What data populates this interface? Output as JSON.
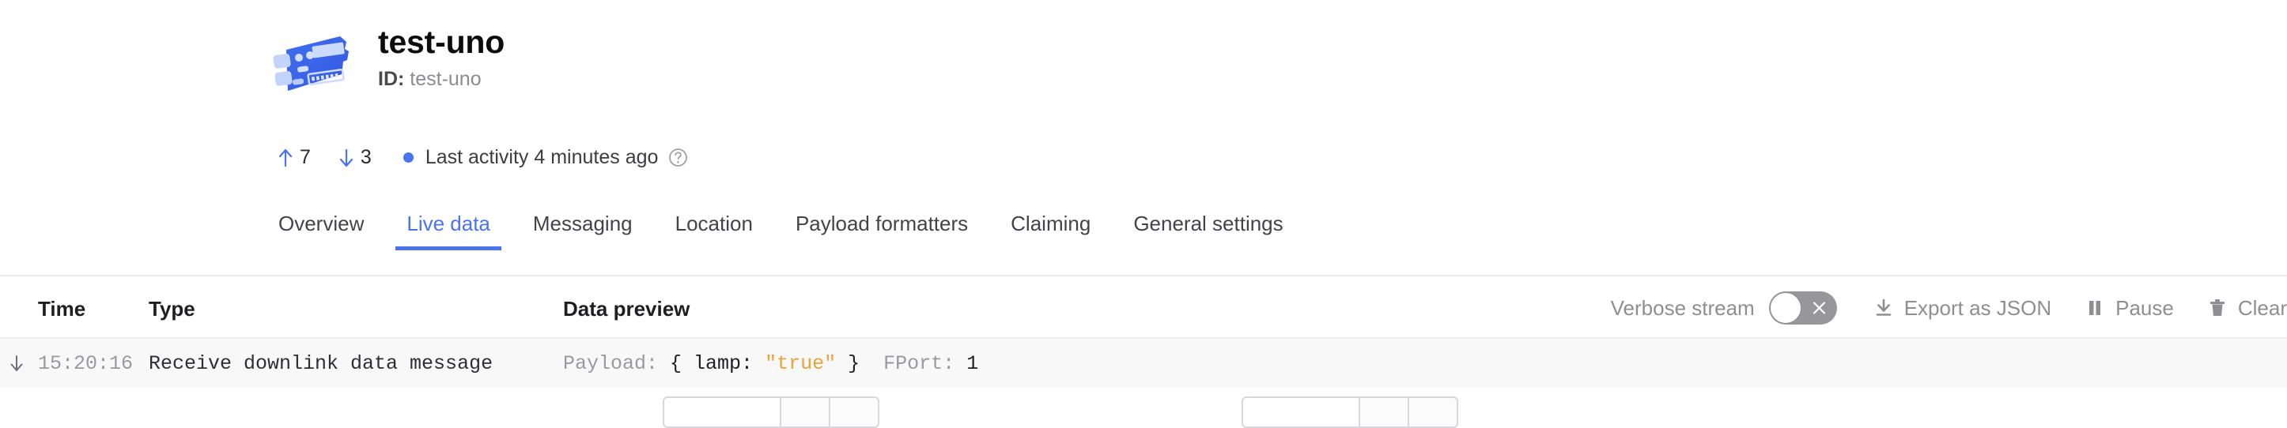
{
  "device": {
    "icon": "dev-board-icon",
    "title": "test-uno",
    "id_label": "ID:",
    "id_value": "test-uno"
  },
  "status": {
    "uplink_icon": "arrow-up-icon",
    "uplink_count": "7",
    "downlink_icon": "arrow-down-icon",
    "downlink_count": "3",
    "status_dot_color": "#4a73f0",
    "activity_text": "Last activity 4 minutes ago",
    "help_icon": "question-mark-circle-icon"
  },
  "tabs": [
    {
      "label": "Overview",
      "active": false
    },
    {
      "label": "Live data",
      "active": true
    },
    {
      "label": "Messaging",
      "active": false
    },
    {
      "label": "Location",
      "active": false
    },
    {
      "label": "Payload formatters",
      "active": false
    },
    {
      "label": "Claiming",
      "active": false
    },
    {
      "label": "General settings",
      "active": false
    }
  ],
  "table": {
    "headers": {
      "time": "Time",
      "type": "Type",
      "data": "Data preview"
    },
    "rows": [
      {
        "direction_icon": "arrow-down-icon",
        "time": "15:20:16",
        "type": "Receive downlink data message",
        "payload_label": "Payload:",
        "payload_open": "{ lamp:",
        "payload_value": "\"true\"",
        "payload_close": "}",
        "fport_label": "FPort:",
        "fport_value": "1"
      }
    ]
  },
  "toolbar": {
    "verbose_label": "Verbose stream",
    "verbose_enabled": false,
    "toggle_off_icon": "close-x-icon",
    "export_icon": "download-icon",
    "export_label": "Export as JSON",
    "pause_icon": "pause-icon",
    "pause_label": "Pause",
    "clear_icon": "trash-icon",
    "clear_label": "Clear"
  },
  "theme": {
    "accent": "#4a73f0",
    "row_bg": "#f8f8f9",
    "muted": "#8e8e93",
    "string_token": "#e8a33d"
  }
}
